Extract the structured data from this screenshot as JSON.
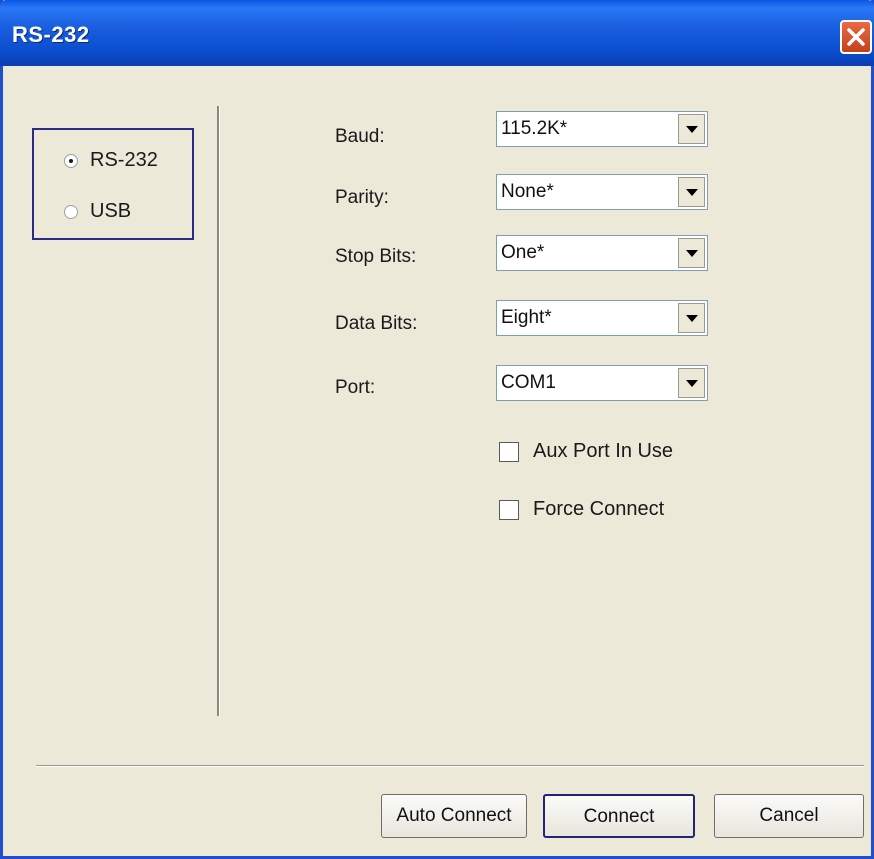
{
  "window": {
    "title": "RS-232"
  },
  "connection_type": {
    "options": [
      {
        "label": "RS-232",
        "selected": true
      },
      {
        "label": "USB",
        "selected": false
      }
    ]
  },
  "settings": {
    "baud": {
      "label": "Baud:",
      "value": "115.2K*"
    },
    "parity": {
      "label": "Parity:",
      "value": "None*"
    },
    "stop_bits": {
      "label": "Stop Bits:",
      "value": "One*"
    },
    "data_bits": {
      "label": "Data Bits:",
      "value": "Eight*"
    },
    "port": {
      "label": "Port:",
      "value": "COM1"
    }
  },
  "options": {
    "aux_port": {
      "label": "Aux Port In Use",
      "checked": false
    },
    "force_connect": {
      "label": "Force Connect",
      "checked": false
    }
  },
  "buttons": {
    "auto_connect": "Auto Connect",
    "connect": "Connect",
    "cancel": "Cancel"
  },
  "colors": {
    "title_bar": "#0a56e4",
    "dialog_bg": "#ece9d8",
    "close_button": "#d9532e",
    "focus_border": "#2b2b86"
  }
}
